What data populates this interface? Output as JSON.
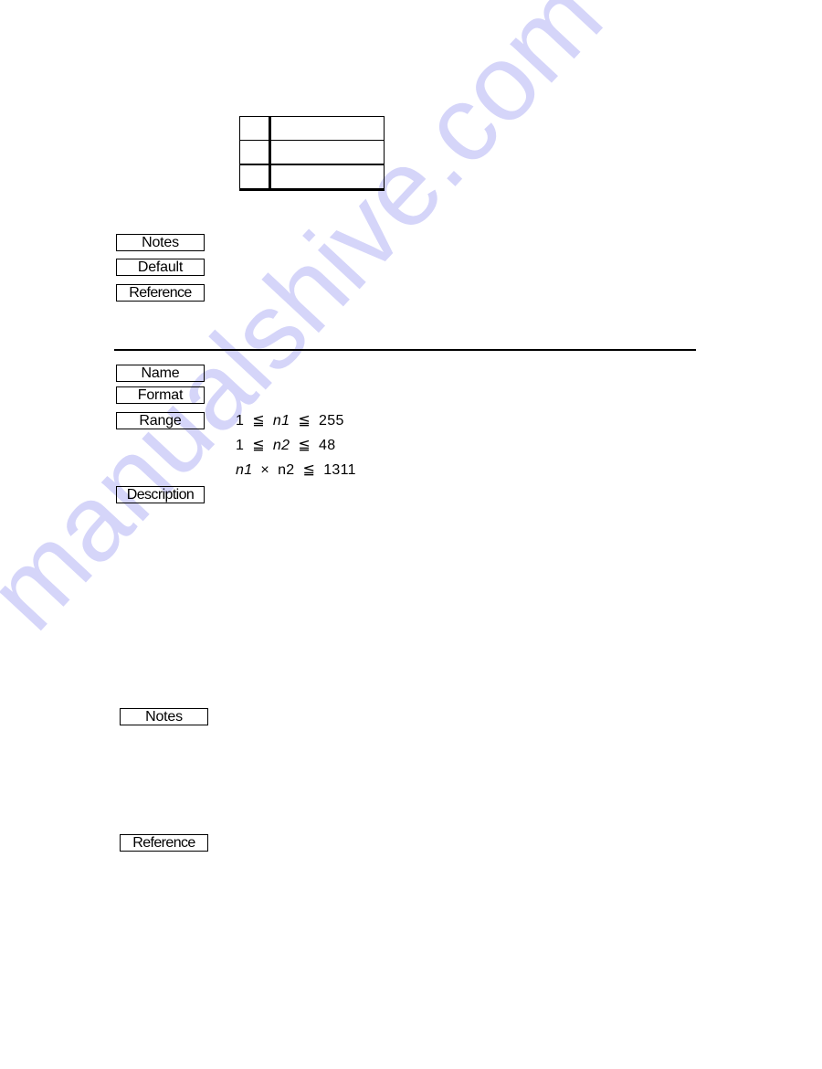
{
  "watermark": {
    "text": "manualshive.com",
    "color": "#d3d3f9"
  },
  "top_table": {
    "rows": [
      [
        "",
        ""
      ],
      [
        "",
        ""
      ],
      [
        "",
        ""
      ]
    ]
  },
  "top_section": {
    "labels": {
      "notes": "Notes",
      "default": "Default",
      "reference": "Reference"
    }
  },
  "command_section": {
    "labels": {
      "name": "Name",
      "format": "Format",
      "range": "Range",
      "description": "Description",
      "notes": "Notes",
      "reference": "Reference"
    },
    "range": [
      {
        "lhs": "1",
        "op1": "≦",
        "var": "n1",
        "op2": "≦",
        "rhs": "255"
      },
      {
        "lhs": "1",
        "op1": "≦",
        "var": "n2",
        "op2": "≦",
        "rhs": "48"
      },
      {
        "lhs_var": "n1",
        "times": "×",
        "mid": "n2",
        "op": "≦",
        "rhs": "1311"
      }
    ]
  }
}
